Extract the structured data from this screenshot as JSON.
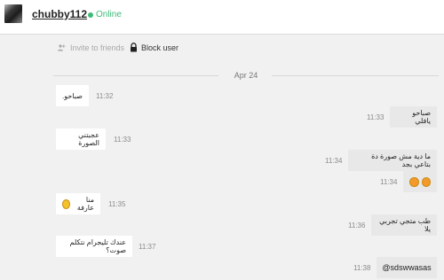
{
  "header": {
    "username": "chubby112",
    "status": "Online",
    "status_color": "#3dbb77"
  },
  "actions": {
    "invite_label": "Invite to friends",
    "block_label": "Block user"
  },
  "divider": {
    "date": "Apr 24"
  },
  "messages": [
    {
      "direction": "in",
      "text": "صباحو.",
      "time": "11:32"
    },
    {
      "direction": "out",
      "text": "صباحو يافلي",
      "time": "11:33"
    },
    {
      "direction": "in",
      "text": "عجبتني الصورة",
      "time": "11:33"
    },
    {
      "direction": "out",
      "text": "ما دية مش صورة دة بتاعي بجد",
      "time": "11:34"
    },
    {
      "direction": "out",
      "text": "",
      "time": "11:34",
      "icons": [
        "angry-emoji-icon",
        "angry-emoji-icon"
      ]
    },
    {
      "direction": "in",
      "text": "منا عارفة",
      "time": "11:35",
      "icons": [
        "smiley-emoji-icon"
      ]
    },
    {
      "direction": "out",
      "text": "طب متجي تجربي يلا",
      "time": "11:36"
    },
    {
      "direction": "in",
      "text": "عندك تليجرام نتكلم صوت؟",
      "time": "11:37"
    },
    {
      "direction": "out",
      "text": "@sdswwasas",
      "time": "11:38"
    }
  ]
}
